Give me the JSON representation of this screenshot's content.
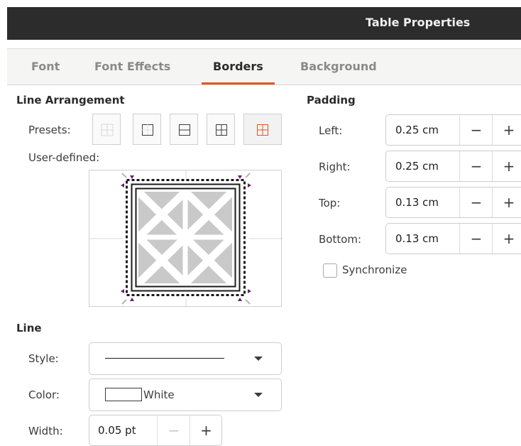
{
  "window": {
    "title": "Table Properties"
  },
  "tabs": [
    {
      "label": "Font",
      "active": false
    },
    {
      "label": "Font Effects",
      "active": false
    },
    {
      "label": "Borders",
      "active": true
    },
    {
      "label": "Background",
      "active": false
    }
  ],
  "line_arrangement": {
    "heading": "Line Arrangement",
    "presets_label": "Presets:",
    "user_defined_label": "User-defined:"
  },
  "padding": {
    "heading": "Padding",
    "fields": [
      {
        "label": "Left:",
        "value": "0.25 cm"
      },
      {
        "label": "Right:",
        "value": "0.25 cm"
      },
      {
        "label": "Top:",
        "value": "0.13 cm"
      },
      {
        "label": "Bottom:",
        "value": "0.13 cm"
      }
    ],
    "minus": "−",
    "plus": "+",
    "synchronize": {
      "label": "Synchronize",
      "checked": false
    }
  },
  "line": {
    "heading": "Line",
    "style_label": "Style:",
    "color_label": "Color:",
    "color_value": "White",
    "width_label": "Width:",
    "width_value": "0.05 pt",
    "minus": "−",
    "plus": "+"
  },
  "colors": {
    "accent": "#e95420",
    "titlebar": "#2c2c2c",
    "marker": "#6a1e6e"
  }
}
